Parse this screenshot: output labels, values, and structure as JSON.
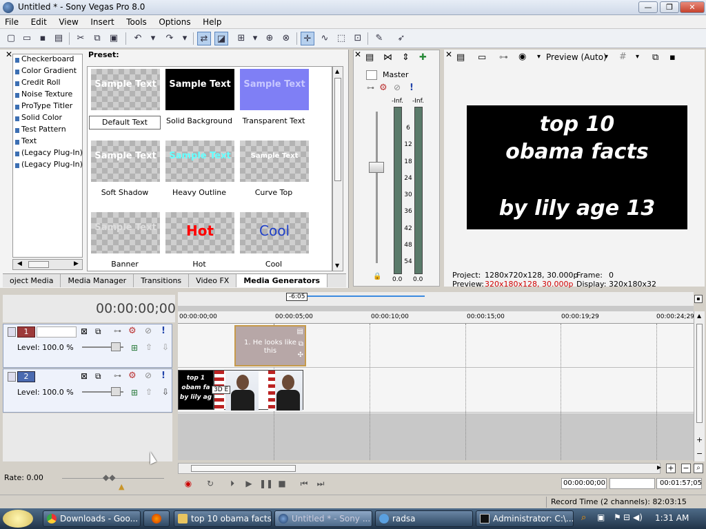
{
  "window": {
    "title": "Untitled * - Sony Vegas Pro 8.0",
    "minimize": "—",
    "maximize": "❐",
    "close": "✕"
  },
  "menu": [
    "File",
    "Edit",
    "View",
    "Insert",
    "Tools",
    "Options",
    "Help"
  ],
  "generators": {
    "list": [
      "Checkerboard",
      "Color Gradient",
      "Credit Roll",
      "Noise Texture",
      "ProType Titler",
      "Solid Color",
      "Test Pattern",
      "Text",
      "(Legacy Plug-In) T",
      "(Legacy Plug-In) V"
    ],
    "preset_label": "Preset:",
    "presets": [
      {
        "name": "Default Text",
        "sample": "Sample Text"
      },
      {
        "name": "Solid Background",
        "sample": "Sample Text"
      },
      {
        "name": "Transparent Text",
        "sample": "Sample Text"
      },
      {
        "name": "Soft Shadow",
        "sample": "Sample Text"
      },
      {
        "name": "Heavy Outline",
        "sample": "Sample Text"
      },
      {
        "name": "Curve Top",
        "sample": "Sample Text"
      },
      {
        "name": "Banner",
        "sample": "Sample Text"
      },
      {
        "name": "Hot",
        "sample": "Hot"
      },
      {
        "name": "Cool",
        "sample": "Cool"
      }
    ]
  },
  "tabs": [
    "oject Media",
    "Media Manager",
    "Transitions",
    "Video FX",
    "Media Generators"
  ],
  "mixer": {
    "label": "Master",
    "peak_left": "-Inf.",
    "peak_right": "-Inf.",
    "scale": [
      "6",
      "12",
      "18",
      "24",
      "30",
      "36",
      "42",
      "48",
      "54"
    ],
    "level_left": "0.0",
    "level_right": "0.0"
  },
  "preview": {
    "mode": "Preview (Auto)",
    "lines": [
      "top 10",
      "obama facts",
      "",
      "by lily age 13"
    ],
    "project_label": "Project:",
    "project_value": "1280x720x128, 30.000p",
    "preview_label": "Preview:",
    "preview_value": "320x180x128, 30.000p",
    "frame_label": "Frame:",
    "frame_value": "0",
    "display_label": "Display:",
    "display_value": "320x180x32"
  },
  "timeline": {
    "timecode": "00:00:00;00",
    "region": "-6:05",
    "ruler": [
      "00:00:00;00",
      "00:00:05;00",
      "00:00:10;00",
      "00:00:15;00",
      "00:00:19;29",
      "00:00:24;29"
    ],
    "tracks": [
      {
        "num": "1",
        "level": "Level: 100.0 %"
      },
      {
        "num": "2",
        "level": "Level: 100.0 %"
      }
    ],
    "clip_text": "1. He looks like this",
    "clip_title_lines": [
      "top 1",
      "obam fa",
      "by lily ag"
    ],
    "clip_fx": "3D E",
    "rate": "Rate: 0.00",
    "pos_time": "00:00:00;00",
    "end_time": "00:01:57;05",
    "record_time": "Record Time (2 channels): 82:03:15"
  },
  "colors": {
    "accent": "#3c6fb3",
    "preview_info_red": "#d00000",
    "clip_gold": "#c69a4a"
  },
  "taskbar": {
    "items": [
      "Downloads - Goo...",
      "",
      "top 10 obama facts",
      "Untitled * - Sony ...",
      "radsa",
      "Administrator: C:\\..."
    ],
    "clock": "1:31 AM"
  }
}
